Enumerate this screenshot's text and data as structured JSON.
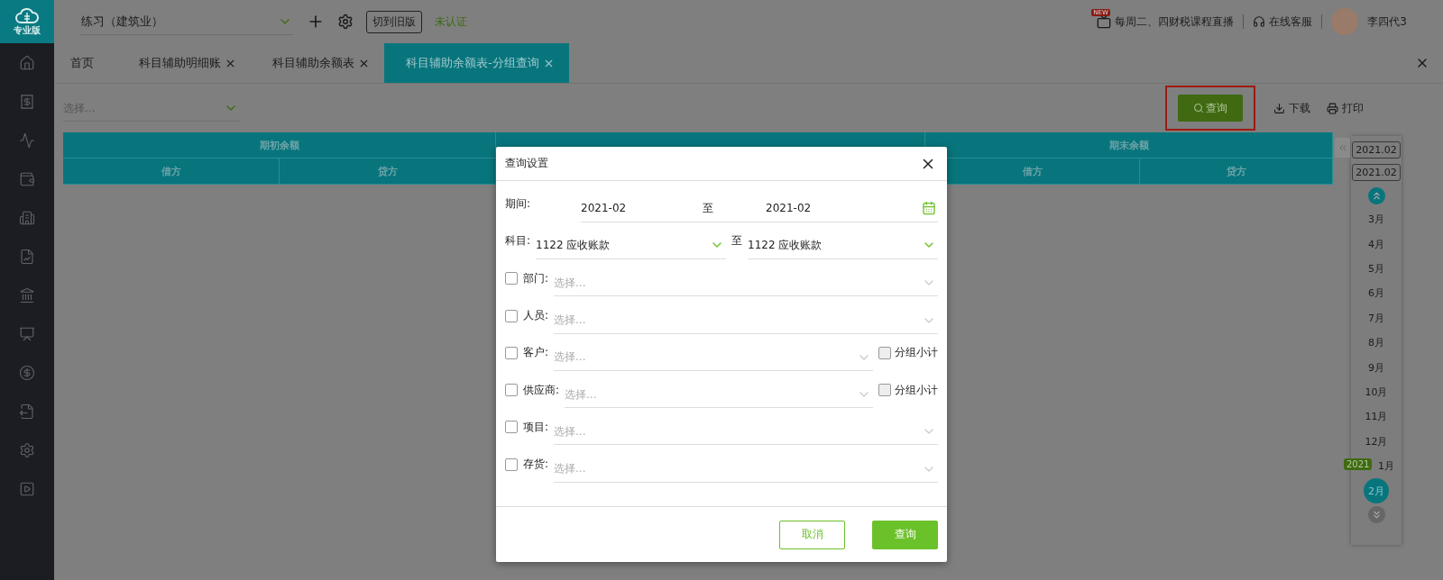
{
  "logo": {
    "text": "专业版"
  },
  "topbar": {
    "account": "练习（建筑业）",
    "switch_button": "切到旧版",
    "status": "未认证",
    "promo_badge": "NEW",
    "promo": "每周二、四财税课程直播",
    "service": "在线客服",
    "user": "李四代3"
  },
  "tabs": [
    {
      "label": "首页",
      "closable": false,
      "selected": false
    },
    {
      "label": "科目辅助明细账",
      "closable": true,
      "selected": false
    },
    {
      "label": "科目辅助余额表",
      "closable": true,
      "selected": false
    },
    {
      "label": "科目辅助余额表-分组查询",
      "closable": true,
      "selected": true
    }
  ],
  "toolbar": {
    "select_placeholder": "选择...",
    "buttons": [
      {
        "kind": "primary",
        "label": "查询",
        "highlighted": true
      },
      {
        "kind": "download",
        "label": "下载",
        "highlighted": false
      },
      {
        "kind": "print",
        "label": "打印",
        "highlighted": false
      }
    ]
  },
  "table": {
    "groups": [
      {
        "label": "期初余额",
        "columns": [
          "借方",
          "贷方"
        ]
      },
      {
        "label": "期末余额",
        "columns": [
          "借方",
          "贷方"
        ]
      }
    ]
  },
  "period_panel": {
    "range_start": "2021.02",
    "range_end": "2021.02",
    "year_badge": "2021",
    "months": [
      {
        "label": "3月",
        "selected": false
      },
      {
        "label": "4月",
        "selected": false
      },
      {
        "label": "5月",
        "selected": false
      },
      {
        "label": "6月",
        "selected": false
      },
      {
        "label": "7月",
        "selected": false
      },
      {
        "label": "8月",
        "selected": false
      },
      {
        "label": "9月",
        "selected": false
      },
      {
        "label": "10月",
        "selected": false
      },
      {
        "label": "11月",
        "selected": false
      },
      {
        "label": "12月",
        "selected": false
      },
      {
        "label": "1月",
        "selected": false
      },
      {
        "label": "2月",
        "selected": true
      }
    ]
  },
  "dialog": {
    "title": "查询设置",
    "period": {
      "label": "期间:",
      "from": "2021-02",
      "separator": "至",
      "to": "2021-02"
    },
    "subject": {
      "label": "科目:",
      "from": "1122 应收账款",
      "separator": "至",
      "to": "1122 应收账款"
    },
    "filters": [
      {
        "label": "部门:",
        "placeholder": "选择...",
        "checked": false
      },
      {
        "label": "人员:",
        "placeholder": "选择...",
        "checked": false
      },
      {
        "label": "客户:",
        "placeholder": "选择...",
        "checked": false,
        "subtotal": {
          "label": "分组小计",
          "checked": false
        }
      },
      {
        "label": "供应商:",
        "placeholder": "选择...",
        "checked": false,
        "subtotal": {
          "label": "分组小计",
          "checked": false
        }
      },
      {
        "label": "项目:",
        "placeholder": "选择...",
        "checked": false
      },
      {
        "label": "存货:",
        "placeholder": "选择...",
        "checked": false
      }
    ],
    "cancel": "取消",
    "ok": "查询"
  }
}
